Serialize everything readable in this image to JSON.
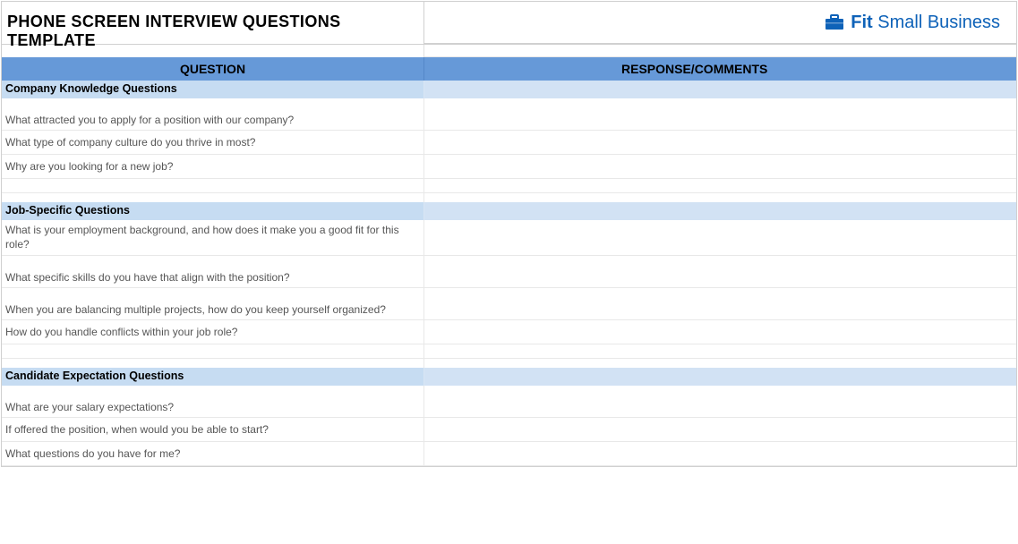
{
  "title": "PHONE SCREEN INTERVIEW QUESTIONS TEMPLATE",
  "logo": {
    "fit": "Fit",
    "rest": " Small Business"
  },
  "columns": {
    "question": "QUESTION",
    "response": "RESPONSE/COMMENTS"
  },
  "sections": [
    {
      "title": "Company Knowledge Questions",
      "questions": [
        "What attracted you to apply for a position with our company?",
        "What type of company culture do you thrive in most?",
        "Why are you looking for a new job?"
      ]
    },
    {
      "title": "Job-Specific Questions",
      "questions": [
        "What is your employment background, and how does it make you a good fit for this role?",
        "What specific skills do you have that align with the position?",
        "When you are balancing multiple projects, how do you keep yourself organized?",
        "How do you handle conflicts within your job role?"
      ]
    },
    {
      "title": "Candidate Expectation Questions",
      "questions": [
        "What are your salary expectations?",
        "If offered the position, when would you be able to start?",
        "What questions do you have for me?"
      ]
    }
  ]
}
